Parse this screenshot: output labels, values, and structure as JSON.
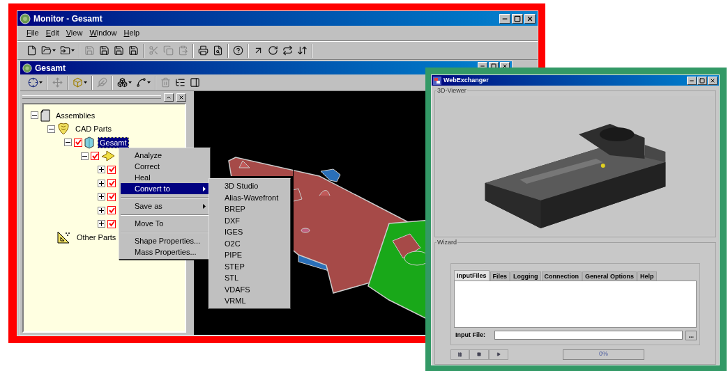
{
  "monitor_window": {
    "title": "Monitor - Gesamt",
    "menu": [
      "File",
      "Edit",
      "View",
      "Window",
      "Help"
    ],
    "document_window": {
      "title": "Gesamt",
      "tree": [
        {
          "label": "Assemblies",
          "kind": "assembly",
          "selected": false,
          "expanded": true,
          "children": [
            {
              "label": "CAD Parts",
              "kind": "group",
              "selected": false,
              "expanded": true,
              "children": [
                {
                  "label": "Gesamt",
                  "kind": "part",
                  "selected": true,
                  "checked": true,
                  "expanded": true,
                  "children": [
                    {
                      "kind": "shape",
                      "checked": true,
                      "expanded": true,
                      "children": [
                        {
                          "checked": true,
                          "expanded": false
                        },
                        {
                          "checked": true,
                          "expanded": false
                        },
                        {
                          "checked": true,
                          "expanded": false
                        },
                        {
                          "checked": true,
                          "expanded": false
                        },
                        {
                          "checked": true,
                          "expanded": false
                        }
                      ]
                    }
                  ]
                }
              ]
            },
            {
              "label": "Other Parts",
              "kind": "other",
              "selected": false
            }
          ]
        }
      ]
    },
    "context_menu": [
      {
        "kind": "item",
        "label": "Analyze",
        "selected": false,
        "submenu": false
      },
      {
        "kind": "item",
        "label": "Correct",
        "selected": false,
        "submenu": false
      },
      {
        "kind": "item",
        "label": "Heal",
        "selected": false,
        "submenu": false
      },
      {
        "kind": "item",
        "label": "Convert to",
        "selected": true,
        "submenu": true
      },
      {
        "kind": "separator"
      },
      {
        "kind": "item",
        "label": "Save as",
        "selected": false,
        "submenu": true
      },
      {
        "kind": "separator"
      },
      {
        "kind": "item",
        "label": "Move To",
        "selected": false,
        "submenu": false
      },
      {
        "kind": "separator"
      },
      {
        "kind": "item",
        "label": "Shape Properties...",
        "selected": false,
        "submenu": false
      },
      {
        "kind": "item",
        "label": "Mass Properties...",
        "selected": false,
        "submenu": false
      }
    ],
    "submenu": [
      {
        "label": "3D Studio",
        "selected": false
      },
      {
        "label": "Alias-Wavefront",
        "selected": false
      },
      {
        "label": "BREP",
        "selected": false
      },
      {
        "label": "DXF",
        "selected": false
      },
      {
        "label": "IGES",
        "selected": false
      },
      {
        "label": "O2C",
        "selected": false
      },
      {
        "label": "PIPE",
        "selected": false
      },
      {
        "label": "STEP",
        "selected": false
      },
      {
        "label": "STL",
        "selected": false
      },
      {
        "label": "VDAFS",
        "selected": false
      },
      {
        "label": "VRML",
        "selected": false
      }
    ]
  },
  "webexchanger": {
    "title": "WebExchanger",
    "viewer_group": "3D-Viewer",
    "wizard_group": "Wizard",
    "tabs": [
      {
        "label": "InputFiles",
        "selected": true
      },
      {
        "label": "Files",
        "selected": false
      },
      {
        "label": "Logging",
        "selected": false
      },
      {
        "label": "Connection",
        "selected": false
      },
      {
        "label": "General Options",
        "selected": false
      },
      {
        "label": "Help",
        "selected": false
      }
    ],
    "input_file": {
      "label": "Input File:",
      "browse": "..."
    },
    "progress": {
      "level": 0,
      "reading": "0%"
    }
  }
}
